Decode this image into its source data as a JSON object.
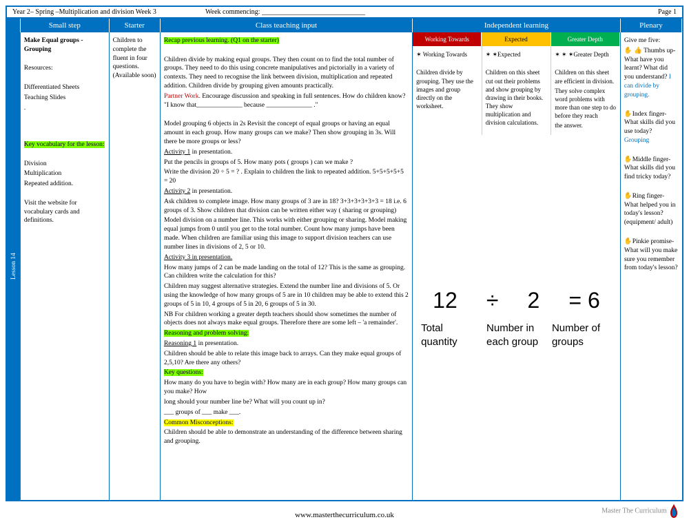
{
  "top": {
    "left": "Year 2– Spring –Multiplication and division Week 3",
    "mid": "Week commencing: ______________________________",
    "right": "Page 1"
  },
  "head": {
    "step": "Small step",
    "starter": "Starter",
    "teach": "Class teaching input",
    "indep": "Independent learning",
    "plenary": "Plenary"
  },
  "lesson_tab": "Lesson 14",
  "smallstep": {
    "title": "Make Equal groups - Grouping",
    "res_h": "Resources:",
    "res1": "Differentiated Sheets",
    "res2": "Teaching Slides",
    "vocab_h": "Key vocabulary for the lesson:",
    "v1": "Division",
    "v2": "Multiplication",
    "v3": "Repeated addition.",
    "note": "Visit the website for vocabulary cards and definitions."
  },
  "starter": "Children to complete the fluent in four questions. (Available soon)",
  "teach": {
    "recap": "Recap previous learning. (Q1 on the starter)",
    "p1": "Children divide by making equal groups. They then count on to find the total number of groups. They need to do this using concrete manipulatives and pictorially in a variety of contexts. They need to recognise the link between division, multiplication and repeated addition. Children divide by grouping given amounts practically.",
    "partner": "Partner Work.",
    "p2": "Encourage discussion and speaking in full sentences. How do children know?  \"I know that______________ because ______________ .\"",
    "p3": "Model grouping 6 objects in 2s  Revisit the concept of equal groups or having an equal amount in each group. How many groups can we make? Then show grouping in 3s. Will there be more groups or less?",
    "a1": "Activity 1",
    "a1t": " in presentation.",
    "p4": "Put the pencils in groups of 5. How many pots ( groups )  can we make ?",
    "p5": "Write the division 20 ÷ 5 = ? . Explain to children the link to repeated addition.  5+5+5+5+5 = 20",
    "a2": "Activity 2",
    "a2t": " in presentation.",
    "p6": "Ask children to complete image. How many groups of 3 are in 18? 3+3+3+3+3+3 = 18 i.e. 6 groups of 3. Show children that division can be written either way ( sharing or grouping)",
    "p7": "Model division on a number line. This works with either grouping or sharing. Model making equal jumps from 0 until you get to the total number. Count how many jumps have been made.  When children are familiar using this image to support division teachers can use number lines in divisions  of 2, 5 or 10.",
    "a3": "Activity 3 in presentation.",
    "p8": "How many jumps of 2 can be made landing on the total of 12? This is the same as grouping. Can children write the calculation for this?",
    "p9": "Children may suggest alternative strategies. Extend the number line and divisions of 5. Or using the knowledge of how many groups of 5 are in 10 children may be able to extend this 2 groups of 5 in 10, 4 groups of 5 in 20, 6 groups of 5 in 30.",
    "p10": "NB For children working a greater depth teachers should show sometimes the number of objects does not always make equal groups. Therefore there are some left – 'a remainder'.",
    "rps": "Reasoning and problem solving:",
    "r1": "Reasoning 1",
    "r1t": " in presentation.",
    "p11": "Children should be able to relate this image back to arrays. Can they make equal groups of 2,5,10? Are there any others?",
    "kq": "Key questions:",
    "p12": "How many do you have to begin with? How many are in each group? How many groups can you make? How",
    "p13": "long should your number line be? What will you count up in?",
    "p14": "___ groups of ___ make ___.",
    "cm": "Common Misconceptions:",
    "p15": "Children should be able to demonstrate an understanding of the difference between sharing and grouping."
  },
  "indep": {
    "wt_h": "Working Towards",
    "ex_h": "Expected",
    "gd_h": "Greater Depth",
    "wt_s": "✶ Working Towards",
    "wt_t": "Children divide by grouping. They use the images and group directly on the worksheet.",
    "ex_s": "✶ ✶Expected",
    "ex_t": "Children on this sheet cut out their problems and show grouping by drawing in their books. They show multiplication and division calculations.",
    "gd_s": "✶ ✶ ✶Greater Depth",
    "gd_t": "Children on this sheet are efficient in division.",
    "gd_t2": "They solve complex word problems with more than one step to do before they reach",
    "gd_t3": "the answer."
  },
  "eq": {
    "a": "12",
    "op": "÷",
    "b": "2",
    "eq": "= 6"
  },
  "lbl": {
    "a": "Total quantity",
    "b": "Number in each group",
    "c": "Number of groups"
  },
  "plenary": {
    "h": "Give me five:",
    "t1a": "✋ 👍 Thumbs up- What have you learnt? What did you understand?",
    "t1b": "I can divide by grouping.",
    "t2a": "✋Index finger- What skills did you use today?",
    "t2b": "Grouping",
    "t3": "✋Middle finger- What skills did you find tricky today?",
    "t4": "✋Ring finger- What helped you in today's lesson? (equipment/ adult)",
    "t5": "✋Pinkie promise- What will you make sure you remember from today's lesson?"
  },
  "footer": "www.masterthecurriculum.co.uk",
  "brand": "Master The Curriculum"
}
